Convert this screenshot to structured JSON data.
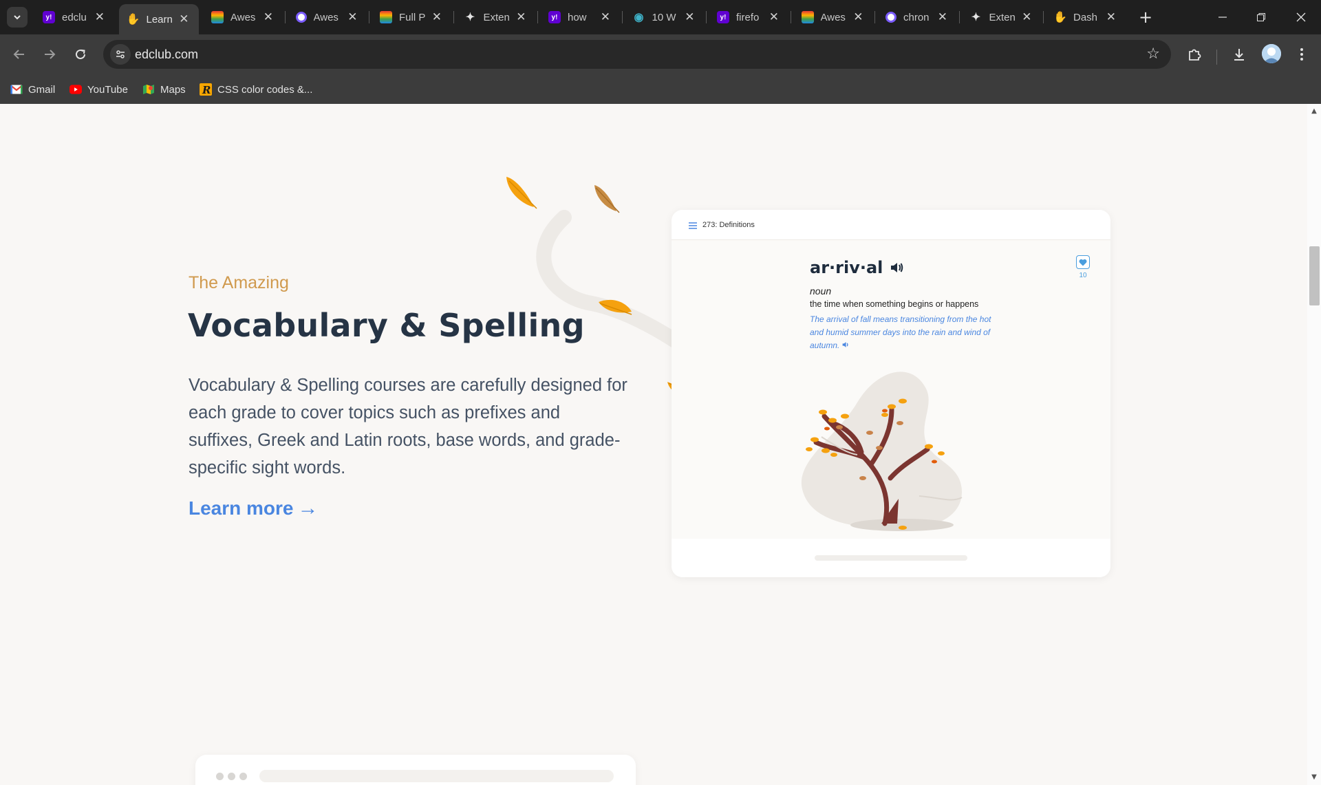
{
  "browser": {
    "tabs": [
      {
        "label": "edclu",
        "favicon": "yahoo-icon",
        "color": "#6001d2"
      },
      {
        "label": "Learn",
        "favicon": "edclub-icon",
        "color": "#f29100",
        "active": true
      },
      {
        "label": "Awes",
        "favicon": "rainbow-icon",
        "color": "#ffffff"
      },
      {
        "label": "Awes",
        "favicon": "ring-icon",
        "color": "#7b5cff"
      },
      {
        "label": "Full P",
        "favicon": "rainbow-icon",
        "color": "#ffffff"
      },
      {
        "label": "Exten",
        "favicon": "puzzle-icon",
        "color": "#e3e3e3"
      },
      {
        "label": "how",
        "favicon": "yahoo-icon",
        "color": "#6001d2"
      },
      {
        "label": "10 W",
        "favicon": "globe-icon",
        "color": "#3fb3c9"
      },
      {
        "label": "firefo",
        "favicon": "yahoo-icon",
        "color": "#6001d2"
      },
      {
        "label": "Awes",
        "favicon": "rainbow-icon",
        "color": "#ffffff"
      },
      {
        "label": "chron",
        "favicon": "ring-icon",
        "color": "#7b5cff"
      },
      {
        "label": "Exten",
        "favicon": "puzzle-icon",
        "color": "#e3e3e3"
      },
      {
        "label": "Dash",
        "favicon": "edclub-icon",
        "color": "#f29100"
      }
    ],
    "url": "edclub.com",
    "bookmarks": [
      {
        "label": "Gmail",
        "icon": "gmail-icon"
      },
      {
        "label": "YouTube",
        "icon": "youtube-icon"
      },
      {
        "label": "Maps",
        "icon": "maps-icon"
      },
      {
        "label": "CSS color codes &...",
        "icon": "r-logo-icon"
      }
    ]
  },
  "hero": {
    "eyebrow": "The Amazing",
    "title": "Vocabulary & Spelling",
    "description": "Vocabulary & Spelling courses are carefully designed for each grade to cover topics such as prefixes and suffixes, Greek and Latin roots, base words, and grade-specific sight words.",
    "cta": "Learn more",
    "cta_arrow": "→"
  },
  "definition_card": {
    "header": "273: Definitions",
    "word": "ar·riv·al",
    "part_of_speech": "noun",
    "definition": "the time when something begins or happens",
    "example": "The arrival of fall means transitioning from the hot and humid summer days into the rain and wind of autumn.",
    "favorite_count": "10"
  },
  "colors": {
    "accent": "#4a86e0",
    "eyebrow": "#d09a4e",
    "heading": "#263445",
    "leaf": "#f5a10f"
  }
}
